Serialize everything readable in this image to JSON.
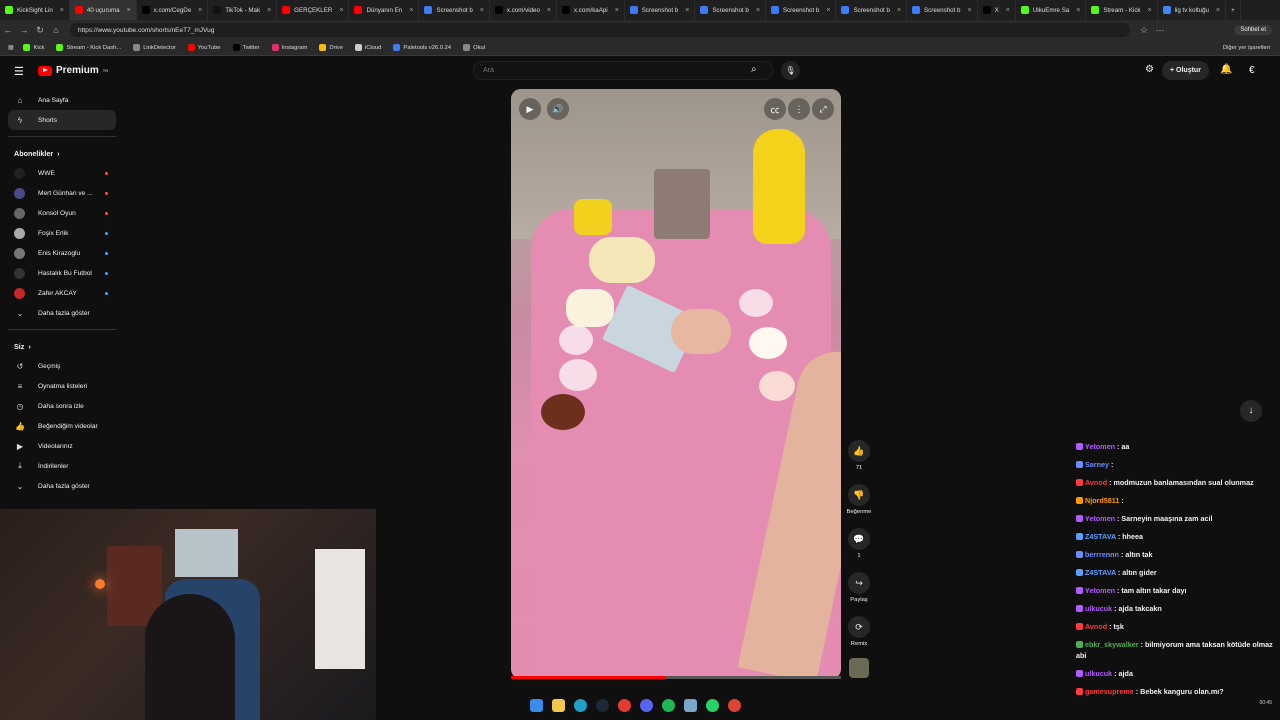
{
  "browser": {
    "tabs": [
      {
        "label": "KickSight Lin",
        "color": "#53fc18",
        "active": false
      },
      {
        "label": "40 uçuruma",
        "color": "#ff0000",
        "active": true
      },
      {
        "label": "x.com/CegDe",
        "color": "#000000",
        "active": false
      },
      {
        "label": "TikTok - Mak",
        "color": "#111111",
        "active": false
      },
      {
        "label": "GERÇEKLER",
        "color": "#ff0000",
        "active": false
      },
      {
        "label": "Dünyanın En",
        "color": "#ff0000",
        "active": false
      },
      {
        "label": "Screenshot b",
        "color": "#3b7bf6",
        "active": false
      },
      {
        "label": "x.com/video",
        "color": "#000000",
        "active": false
      },
      {
        "label": "x.com/kaApi",
        "color": "#000000",
        "active": false
      },
      {
        "label": "Screenshot b",
        "color": "#3b7bf6",
        "active": false
      },
      {
        "label": "Screenshot b",
        "color": "#3b7bf6",
        "active": false
      },
      {
        "label": "Screenshot b",
        "color": "#3b7bf6",
        "active": false
      },
      {
        "label": "Screenshot b",
        "color": "#3b7bf6",
        "active": false
      },
      {
        "label": "Screenshot b",
        "color": "#3b7bf6",
        "active": false
      },
      {
        "label": "X",
        "color": "#000000",
        "active": false
      },
      {
        "label": "UlkuEmre Sa",
        "color": "#53fc18",
        "active": false
      },
      {
        "label": "Stream - Kick",
        "color": "#53fc18",
        "active": false
      },
      {
        "label": "lig tv koltuğu",
        "color": "#4285f4",
        "active": false
      }
    ],
    "url": "https://www.youtube.com/shorts/nEeT7_mJVug",
    "chat_button": "Sohbet et",
    "bookmarks": [
      {
        "label": "Kick",
        "color": "#53fc18"
      },
      {
        "label": "Stream - Kick Dash...",
        "color": "#53fc18"
      },
      {
        "label": "LinkDetector",
        "color": "#888888"
      },
      {
        "label": "YouTube",
        "color": "#ff0000"
      },
      {
        "label": "Twitter",
        "color": "#000000"
      },
      {
        "label": "Instagram",
        "color": "#e1306c"
      },
      {
        "label": "Drive",
        "color": "#fbbc04"
      },
      {
        "label": "iCloud",
        "color": "#cccccc"
      },
      {
        "label": "Paletools v26.0.24",
        "color": "#3b7bf6"
      },
      {
        "label": "Okul",
        "color": "#888888"
      }
    ],
    "other_bookmarks": "Diğer yer işaretleri"
  },
  "youtube": {
    "logo_text": "Premium",
    "logo_sup": "TR",
    "search_placeholder": "Ara",
    "create_label": "Oluştur",
    "sidebar": {
      "main": [
        {
          "label": "Ana Sayfa",
          "icon": "home-icon",
          "glyph": "⌂"
        },
        {
          "label": "Shorts",
          "icon": "shorts-icon",
          "glyph": "ϟ",
          "active": true
        }
      ],
      "subs_title": "Abonelikler",
      "subs": [
        {
          "label": "WWE",
          "color": "#222222",
          "live": true
        },
        {
          "label": "Mert Günhan ve ...",
          "color": "#4a4a8a",
          "live": true
        },
        {
          "label": "Konsol Oyun",
          "color": "#666666",
          "live": true
        },
        {
          "label": "Foşix Erlik",
          "color": "#aaaaaa",
          "live": false
        },
        {
          "label": "Enis Kirazoglu",
          "color": "#777777",
          "live": false
        },
        {
          "label": "Hastalık Bu Futbol",
          "color": "#333333",
          "live": false
        },
        {
          "label": "Zafer AKCAY",
          "color": "#c62828",
          "live": false
        }
      ],
      "show_more": "Daha fazla göster",
      "you_title": "Siz",
      "you": [
        {
          "label": "Geçmiş",
          "icon": "history-icon",
          "glyph": "↺"
        },
        {
          "label": "Oynatma listeleri",
          "icon": "playlist-icon",
          "glyph": "≡"
        },
        {
          "label": "Daha sonra izle",
          "icon": "watch-later-icon",
          "glyph": "◷"
        },
        {
          "label": "Beğendiğim videolar",
          "icon": "like-icon",
          "glyph": "👍"
        },
        {
          "label": "Videolarınız",
          "icon": "your-videos-icon",
          "glyph": "▶"
        },
        {
          "label": "İndirilenler",
          "icon": "download-icon",
          "glyph": "⤓"
        }
      ],
      "show_more2": "Daha fazla göster"
    },
    "actions": {
      "like_count": "71",
      "dislike_label": "Beğenme",
      "comments_count": "1",
      "share_label": "Paylaş",
      "remix_label": "Remix"
    },
    "video_progress": 0.47
  },
  "chat": [
    {
      "user": "Yetomen",
      "color": "#b05cff",
      "text": ": aa"
    },
    {
      "user": "Sarney",
      "color": "#6a8cff",
      "text": ":"
    },
    {
      "user": "Avnod",
      "color": "#ff3b3b",
      "text": ": modmuzun banlamasından sual olunmaz"
    },
    {
      "user": "Njord5811",
      "color": "#ff9a00",
      "text": ":"
    },
    {
      "user": "Yetomen",
      "color": "#b05cff",
      "text": ": Sarneyin maaşına zam acil"
    },
    {
      "user": "Z4STAVA",
      "color": "#5aa0ff",
      "text": ": hheea"
    },
    {
      "user": "berrrennn",
      "color": "#6a8cff",
      "text": ": altın tak"
    },
    {
      "user": "Z4STAVA",
      "color": "#5aa0ff",
      "text": ": altın gider"
    },
    {
      "user": "Yetomen",
      "color": "#b05cff",
      "text": ": tam altın takar dayı"
    },
    {
      "user": "ulkucuk",
      "color": "#b05cff",
      "text": ": ajda takcakn"
    },
    {
      "user": "Avnod",
      "color": "#ff3b3b",
      "text": ": tşk"
    },
    {
      "user": "ebkr_skywalker",
      "color": "#4caf50",
      "text": ": bilmiyorum ama taksan kötüde olmaz abi"
    },
    {
      "user": "ulkucuk",
      "color": "#b05cff",
      "text": ": ajda"
    },
    {
      "user": "gamesupreme",
      "color": "#ff3b3b",
      "text": ": Bebek kanguru olan.mı?"
    }
  ],
  "clock": {
    "time": "00:45"
  }
}
